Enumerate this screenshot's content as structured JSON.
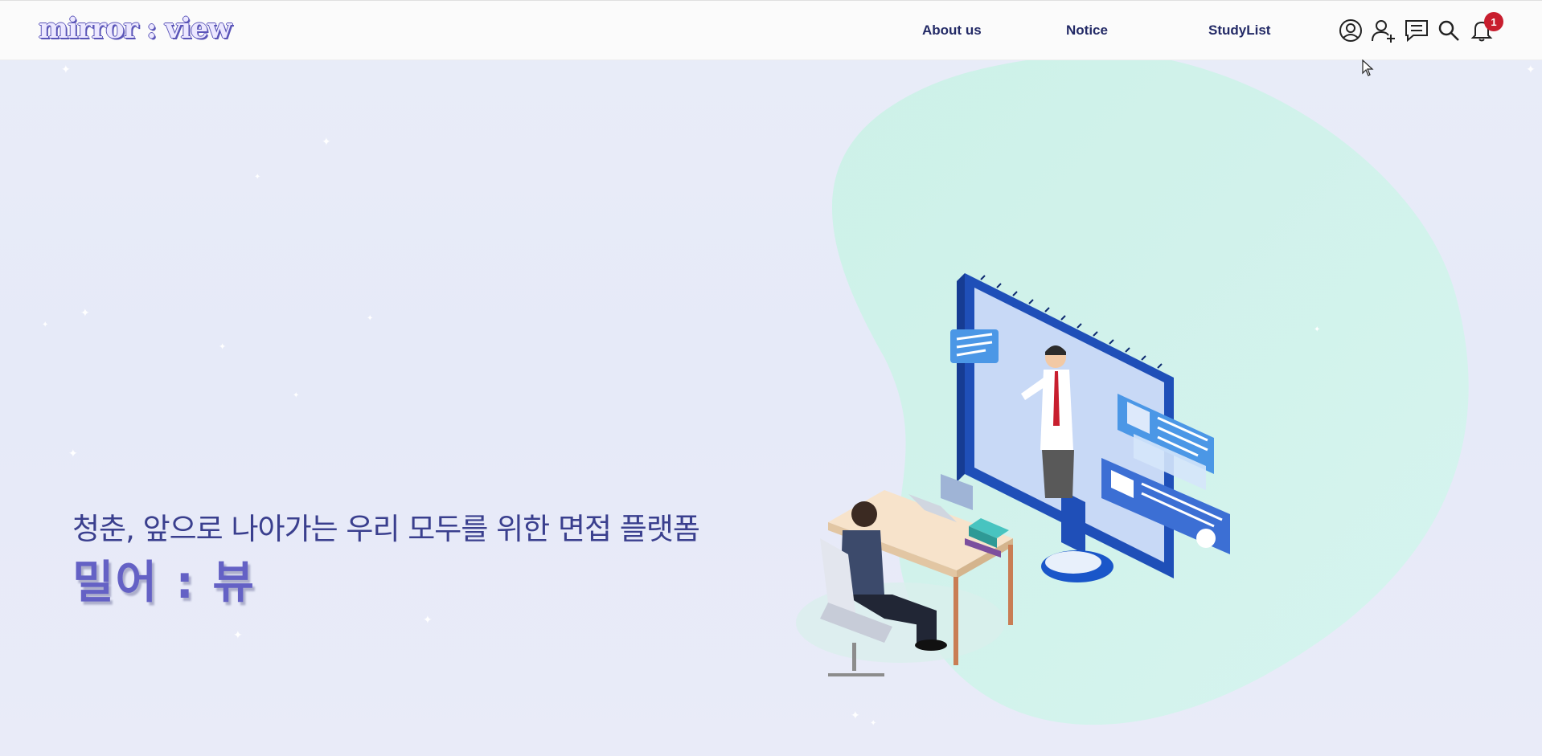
{
  "header": {
    "logo": "mirror : view",
    "nav": {
      "about": "About us",
      "notice": "Notice",
      "studylist": "StudyList"
    },
    "icons": [
      "user-circle-icon",
      "user-add-icon",
      "chat-icon",
      "search-icon",
      "bell-icon"
    ],
    "notification_count": "1"
  },
  "hero": {
    "subtitle": "청춘, 앞으로 나아가는 우리 모두를 위한 면접 플랫폼",
    "title": "밀어 : 뷰"
  },
  "colors": {
    "accent": "#6461c5",
    "nav_text": "#232a66",
    "badge": "#c81e2e",
    "blob": "#c9f1e6"
  }
}
